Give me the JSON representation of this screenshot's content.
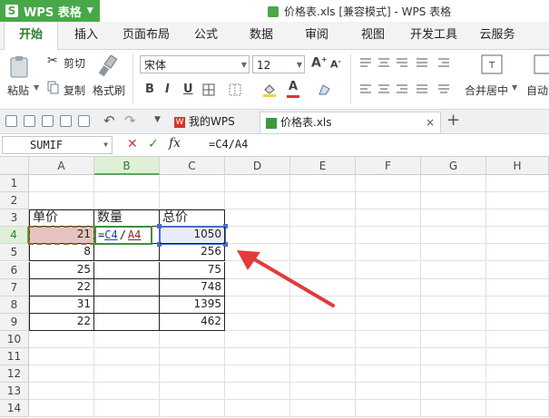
{
  "app": {
    "name": "WPS 表格",
    "logo_letter": "S"
  },
  "window": {
    "title": "价格表.xls [兼容模式] - WPS 表格"
  },
  "menu": {
    "tabs": [
      "开始",
      "插入",
      "页面布局",
      "公式",
      "数据",
      "审阅",
      "视图",
      "开发工具",
      "云服务"
    ],
    "active_index": 0
  },
  "ribbon": {
    "paste": "粘贴",
    "cut": "剪切",
    "copy": "复制",
    "format_painter": "格式刷",
    "font_name": "宋体",
    "font_size": "12",
    "bold": "B",
    "italic": "I",
    "underline": "U",
    "merge_center": "合并居中",
    "auto_wrap": "自动"
  },
  "doctabs": {
    "tabs": [
      {
        "label": "我的WPS",
        "logo": "W"
      },
      {
        "label": "价格表.xls",
        "active": true
      }
    ],
    "close": "×",
    "add": "+"
  },
  "formula_bar": {
    "name_box": "SUMIF",
    "cancel": "✕",
    "ok": "✓",
    "fx": "fx",
    "formula": "=C4/A4"
  },
  "sheet": {
    "columns": [
      "A",
      "B",
      "C",
      "D",
      "E",
      "F",
      "G",
      "H"
    ],
    "selected_column": "B",
    "selected_row": "4",
    "rows": [
      "1",
      "2",
      "3",
      "4",
      "5",
      "6",
      "7",
      "8",
      "9",
      "10",
      "11",
      "12",
      "13",
      "14"
    ],
    "headers": {
      "a3": "单价",
      "b3": "数量",
      "c3": "总价"
    },
    "unit_prices": [
      "21",
      "8",
      "25",
      "22",
      "31",
      "22"
    ],
    "totals": [
      "1050",
      "256",
      "75",
      "748",
      "1395",
      "462"
    ],
    "edit_cell": {
      "prefix": "=",
      "ref1": "C4",
      "op": "/",
      "ref2": "A4"
    }
  }
}
